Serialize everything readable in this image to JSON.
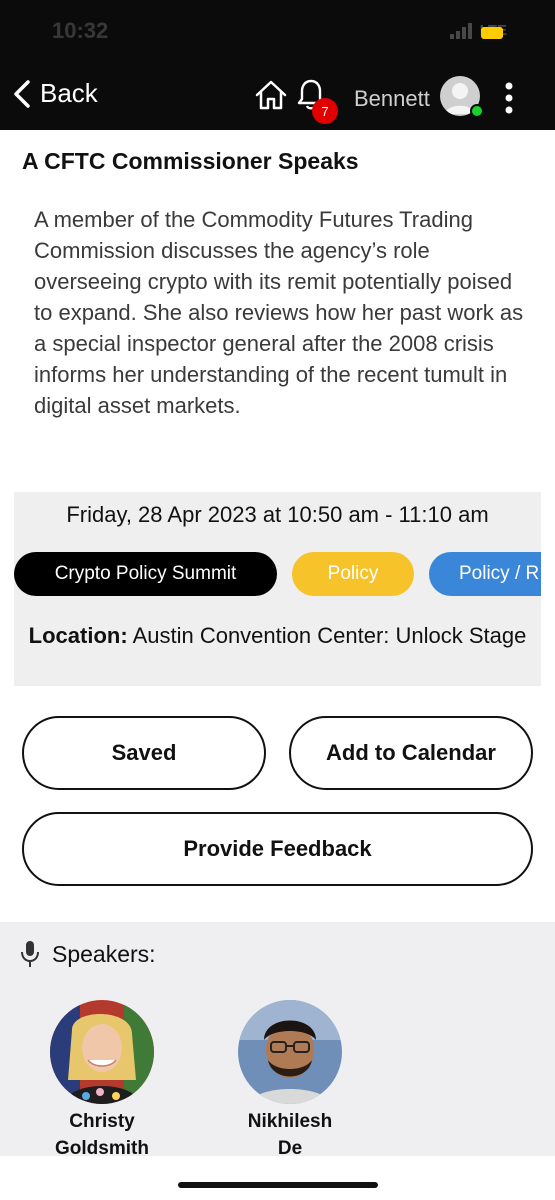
{
  "status_bar": {
    "time": "10:32",
    "network": "LTE"
  },
  "nav": {
    "back_label": "Back",
    "notification_count": "7",
    "username": "Bennett",
    "icons": [
      "home-icon",
      "bell-icon",
      "avatar",
      "more-icon"
    ]
  },
  "session": {
    "title": "A CFTC Commissioner Speaks",
    "description": "A member of the Commodity Futures Trading Commission discusses the agency’s role overseeing crypto with its remit potentially poised to expand. She also reviews how her past work as a special inspector general after the 2008 crisis informs her understanding of the recent tumult in digital asset markets.",
    "datetime": "Friday, 28 Apr 2023 at 10:50 am - 11:10 am",
    "tags": [
      "Crypto Policy Summit",
      "Policy",
      "Policy / R"
    ],
    "location_label": "Location:",
    "location_value": "Austin Convention Center: Unlock Stage"
  },
  "actions": {
    "saved_label": "Saved",
    "calendar_label": "Add to Calendar",
    "feedback_label": "Provide Feedback"
  },
  "speakers": {
    "heading": "Speakers:",
    "list": [
      {
        "first": "Christy",
        "last": "Goldsmith"
      },
      {
        "first": "Nikhilesh",
        "last": "De"
      }
    ]
  },
  "colors": {
    "header_bg": "#0b0b0b",
    "badge": "#e00000",
    "online": "#19d12b",
    "tag_summit": "#000000",
    "tag_policy": "#f6c32a",
    "tag_policy_r": "#3a86d8"
  }
}
